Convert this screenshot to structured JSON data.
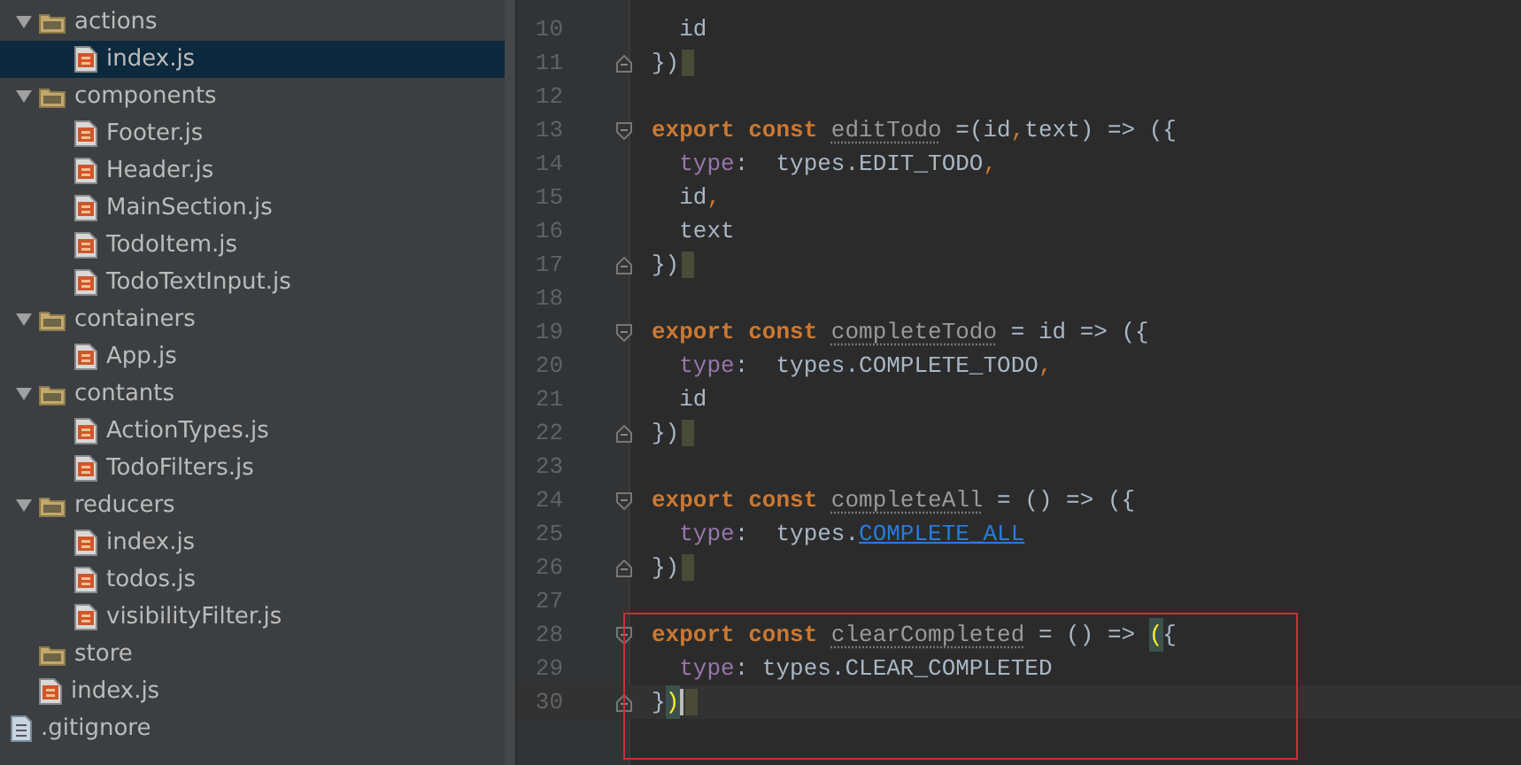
{
  "project_tree": [
    {
      "name": "actions",
      "kind": "folder",
      "expanded": true,
      "selected": false,
      "children": [
        {
          "name": "index.js",
          "kind": "js",
          "selected": true
        }
      ]
    },
    {
      "name": "components",
      "kind": "folder",
      "expanded": true,
      "selected": false,
      "children": [
        {
          "name": "Footer.js",
          "kind": "js",
          "selected": false
        },
        {
          "name": "Header.js",
          "kind": "js",
          "selected": false
        },
        {
          "name": "MainSection.js",
          "kind": "js",
          "selected": false
        },
        {
          "name": "TodoItem.js",
          "kind": "js",
          "selected": false
        },
        {
          "name": "TodoTextInput.js",
          "kind": "js",
          "selected": false
        }
      ]
    },
    {
      "name": "containers",
      "kind": "folder",
      "expanded": true,
      "selected": false,
      "children": [
        {
          "name": "App.js",
          "kind": "js",
          "selected": false
        }
      ]
    },
    {
      "name": "contants",
      "kind": "folder",
      "expanded": true,
      "selected": false,
      "children": [
        {
          "name": "ActionTypes.js",
          "kind": "js",
          "selected": false
        },
        {
          "name": "TodoFilters.js",
          "kind": "js",
          "selected": false
        }
      ]
    },
    {
      "name": "reducers",
      "kind": "folder",
      "expanded": true,
      "selected": false,
      "children": [
        {
          "name": "index.js",
          "kind": "js",
          "selected": false
        },
        {
          "name": "todos.js",
          "kind": "js",
          "selected": false
        },
        {
          "name": "visibilityFilter.js",
          "kind": "js",
          "selected": false
        }
      ]
    },
    {
      "name": "store",
      "kind": "folder",
      "selected": false
    },
    {
      "name": "index.js",
      "kind": "js",
      "selected": false
    }
  ],
  "parent_items": [
    {
      "name": ".gitignore",
      "kind": "text",
      "selected": false
    }
  ],
  "editor": {
    "lines": [
      {
        "number": "10",
        "indent": true,
        "tokens": [
          {
            "kind": "plain",
            "text": "id"
          }
        ]
      },
      {
        "number": "11",
        "fold_end": true,
        "end_marker": true,
        "tokens": [
          {
            "kind": "plain",
            "text": "})"
          }
        ]
      },
      {
        "number": "12"
      },
      {
        "number": "13",
        "fold_start": true,
        "tokens": [
          {
            "kind": "keyword",
            "text": "export"
          },
          {
            "kind": "keyword",
            "text": "const",
            "gap": true
          },
          {
            "kind": "function",
            "text": "editTodo",
            "gap": true
          },
          {
            "kind": "plain",
            "text": "=(id",
            "gap": true
          },
          {
            "kind": "comma",
            "text": ","
          },
          {
            "kind": "plain",
            "text": "text) => ({"
          }
        ]
      },
      {
        "number": "14",
        "indent": true,
        "tokens": [
          {
            "kind": "property",
            "text": "type"
          },
          {
            "kind": "plain",
            "text": ":  types.EDIT_TODO"
          },
          {
            "kind": "comma",
            "text": ","
          }
        ]
      },
      {
        "number": "15",
        "indent": true,
        "tokens": [
          {
            "kind": "plain",
            "text": "id"
          },
          {
            "kind": "comma",
            "text": ","
          }
        ]
      },
      {
        "number": "16",
        "indent": true,
        "tokens": [
          {
            "kind": "plain",
            "text": "text"
          }
        ]
      },
      {
        "number": "17",
        "fold_end": true,
        "end_marker": true,
        "tokens": [
          {
            "kind": "plain",
            "text": "})"
          }
        ]
      },
      {
        "number": "18"
      },
      {
        "number": "19",
        "fold_start": true,
        "tokens": [
          {
            "kind": "keyword",
            "text": "export"
          },
          {
            "kind": "keyword",
            "text": "const",
            "gap": true
          },
          {
            "kind": "function",
            "text": "completeTodo",
            "gap": true
          },
          {
            "kind": "plain",
            "text": "= id => ({",
            "gap": true
          }
        ]
      },
      {
        "number": "20",
        "indent": true,
        "tokens": [
          {
            "kind": "property",
            "text": "type"
          },
          {
            "kind": "plain",
            "text": ":  types.COMPLETE_TODO"
          },
          {
            "kind": "comma",
            "text": ","
          }
        ]
      },
      {
        "number": "21",
        "indent": true,
        "tokens": [
          {
            "kind": "plain",
            "text": "id"
          }
        ]
      },
      {
        "number": "22",
        "fold_end": true,
        "end_marker": true,
        "tokens": [
          {
            "kind": "plain",
            "text": "})"
          }
        ]
      },
      {
        "number": "23"
      },
      {
        "number": "24",
        "fold_start": true,
        "tokens": [
          {
            "kind": "keyword",
            "text": "export"
          },
          {
            "kind": "keyword",
            "text": "const",
            "gap": true
          },
          {
            "kind": "function",
            "text": "completeAll",
            "gap": true
          },
          {
            "kind": "plain",
            "text": "= () => ({",
            "gap": true
          }
        ]
      },
      {
        "number": "25",
        "indent": true,
        "tokens": [
          {
            "kind": "property",
            "text": "type"
          },
          {
            "kind": "plain",
            "text": ":  types."
          },
          {
            "kind": "link",
            "text": "COMPLETE_ALL"
          }
        ]
      },
      {
        "number": "26",
        "fold_end": true,
        "end_marker": true,
        "tokens": [
          {
            "kind": "plain",
            "text": "})"
          }
        ]
      },
      {
        "number": "27"
      },
      {
        "number": "28",
        "fold_start": true,
        "boxed": true,
        "tokens": [
          {
            "kind": "keyword",
            "text": "export"
          },
          {
            "kind": "keyword",
            "text": "const",
            "gap": true
          },
          {
            "kind": "function",
            "text": "clearCompleted",
            "gap": true
          },
          {
            "kind": "plain",
            "text": "= () =>",
            "gap": true
          },
          {
            "kind": "match",
            "text": "(",
            "gap": true
          },
          {
            "kind": "plain",
            "text": "{"
          }
        ]
      },
      {
        "number": "29",
        "indent": true,
        "boxed": true,
        "tokens": [
          {
            "kind": "property",
            "text": "type"
          },
          {
            "kind": "plain",
            "text": ": types.CLEAR_COMPLETED"
          }
        ]
      },
      {
        "number": "30",
        "fold_end": true,
        "boxed": true,
        "current": true,
        "end_marker": true,
        "tokens": [
          {
            "kind": "plain",
            "text": "}"
          },
          {
            "kind": "match",
            "text": ")"
          }
        ]
      }
    ]
  }
}
